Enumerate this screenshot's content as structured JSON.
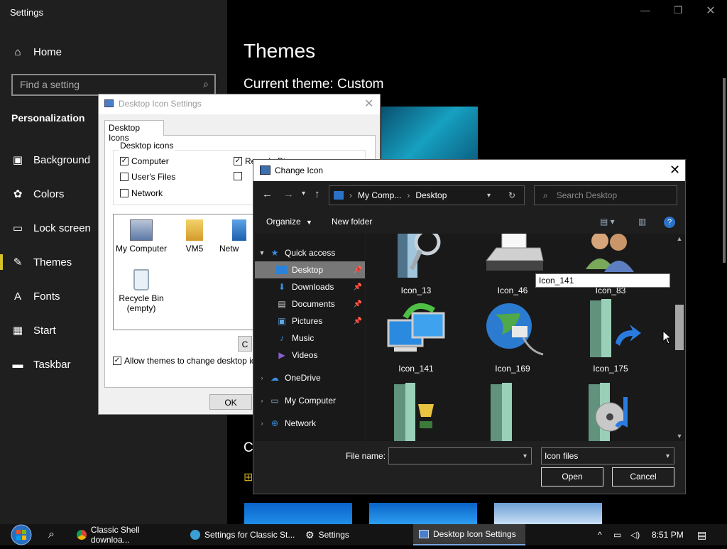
{
  "settings": {
    "window_title": "Settings",
    "search_placeholder": "Find a setting",
    "section": "Personalization",
    "nav": [
      {
        "label": "Home",
        "icon": "home-icon"
      },
      {
        "label": "Background",
        "icon": "image-icon"
      },
      {
        "label": "Colors",
        "icon": "palette-icon"
      },
      {
        "label": "Lock screen",
        "icon": "monitor-icon"
      },
      {
        "label": "Themes",
        "icon": "brush-icon"
      },
      {
        "label": "Fonts",
        "icon": "font-icon"
      },
      {
        "label": "Start",
        "icon": "grid-icon"
      },
      {
        "label": "Taskbar",
        "icon": "taskbar-icon"
      }
    ],
    "main_title": "Themes",
    "current_theme": "Current theme: Custom",
    "partial_letter": "C"
  },
  "desktop_icon_settings": {
    "title": "Desktop Icon Settings",
    "tab": "Desktop Icons",
    "group_label": "Desktop icons",
    "checks": [
      {
        "label": "Computer",
        "checked": true
      },
      {
        "label": "User's Files",
        "checked": false
      },
      {
        "label": "Network",
        "checked": false
      },
      {
        "label": "Recycle Bin",
        "checked": true
      }
    ],
    "icons": [
      {
        "label": "My Computer"
      },
      {
        "label": "VM5"
      },
      {
        "label": "Netw"
      },
      {
        "label": "Recycle Bin (empty)"
      }
    ],
    "allow_themes": "Allow themes to change desktop icon",
    "partial_btn": "C",
    "ok": "OK"
  },
  "change_icon": {
    "title": "Change Icon",
    "address": [
      "My Comp...",
      "Desktop"
    ],
    "search_placeholder": "Search Desktop",
    "organize": "Organize",
    "new_folder": "New folder",
    "tree": [
      {
        "label": "Quick access",
        "level": 0,
        "icon": "star-icon",
        "pin": false
      },
      {
        "label": "Desktop",
        "level": 1,
        "icon": "desktop-icon",
        "pin": true,
        "selected": true
      },
      {
        "label": "Downloads",
        "level": 1,
        "icon": "download-icon",
        "pin": true
      },
      {
        "label": "Documents",
        "level": 1,
        "icon": "documents-icon",
        "pin": true
      },
      {
        "label": "Pictures",
        "level": 1,
        "icon": "pictures-icon",
        "pin": true
      },
      {
        "label": "Music",
        "level": 1,
        "icon": "music-icon",
        "pin": false
      },
      {
        "label": "Videos",
        "level": 1,
        "icon": "video-icon",
        "pin": false
      },
      {
        "label": "OneDrive",
        "level": 0,
        "icon": "cloud-icon",
        "pin": false
      },
      {
        "label": "My Computer",
        "level": 0,
        "icon": "computer-icon",
        "pin": false
      },
      {
        "label": "Network",
        "level": 0,
        "icon": "network-icon",
        "pin": false
      }
    ],
    "icons": [
      {
        "label": "Icon_13",
        "kind": "search-folder"
      },
      {
        "label": "Icon_46",
        "kind": "printer"
      },
      {
        "label": "Icon_83",
        "kind": "users"
      },
      {
        "label": "Icon_141",
        "kind": "monitor-sync"
      },
      {
        "label": "Icon_169",
        "kind": "globe-network"
      },
      {
        "label": "Icon_175",
        "kind": "folder-arrow"
      },
      {
        "label": "",
        "kind": "trophy"
      },
      {
        "label": "",
        "kind": "folder"
      },
      {
        "label": "",
        "kind": "disc-music"
      }
    ],
    "rename_value": "Icon_141",
    "file_name_label": "File name:",
    "file_name_value": "",
    "file_type": "Icon files",
    "open": "Open",
    "cancel": "Cancel"
  },
  "taskbar": {
    "items": [
      {
        "label": "Classic Shell downloa...",
        "icon": "chrome-icon"
      },
      {
        "label": "Settings for Classic St...",
        "icon": "shell-icon"
      },
      {
        "label": "Settings",
        "icon": "gear-icon"
      },
      {
        "label": "Desktop Icon Settings",
        "icon": "display-icon",
        "active": true
      }
    ],
    "time": "8:51 PM"
  },
  "colors": {
    "accent_bar": "#d4c428",
    "selection_gray": "#777777"
  }
}
